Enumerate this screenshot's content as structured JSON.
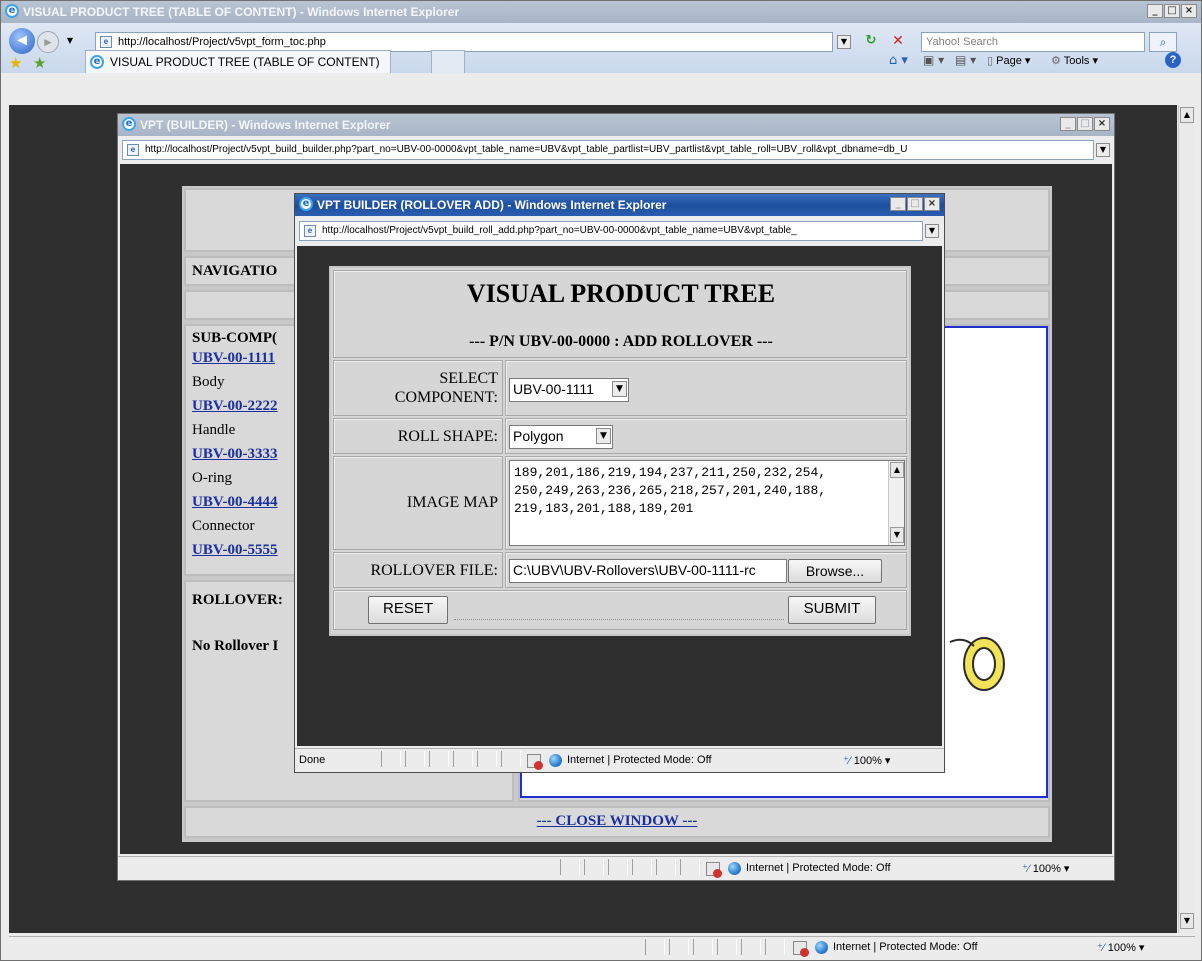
{
  "outer_window": {
    "title": "VISUAL PRODUCT TREE (TABLE OF CONTENT) - Windows Internet Explorer",
    "address": "http://localhost/Project/v5vpt_form_toc.php",
    "search_placeholder": "Yahoo! Search",
    "tab_label": "VISUAL PRODUCT TREE (TABLE OF CONTENT)",
    "toolbar": {
      "page_label": "Page",
      "tools_label": "Tools"
    },
    "status": {
      "zone_text": "Internet | Protected Mode: Off",
      "zoom": "100%"
    }
  },
  "builder_window": {
    "title": "VPT (BUILDER) - Windows Internet Explorer",
    "address": "http://localhost/Project/v5vpt_build_builder.php?part_no=UBV-00-0000&vpt_table_name=UBV&vpt_table_partlist=UBV_partlist&vpt_table_roll=UBV_roll&vpt_dbname=db_U",
    "page": {
      "navigation_heading": "NAVIGATIO",
      "sub_components_heading": "SUB-COMP(",
      "components": [
        {
          "part_no": "UBV-00-1111",
          "name": "Body"
        },
        {
          "part_no": "UBV-00-2222",
          "name": "Handle"
        },
        {
          "part_no": "UBV-00-3333",
          "name": "O-ring"
        },
        {
          "part_no": "UBV-00-4444",
          "name": "Connector"
        },
        {
          "part_no": "UBV-00-5555",
          "name": ""
        }
      ],
      "rollovers_heading": "ROLLOVER:",
      "no_rollover_text": "No Rollover I",
      "close_link": "--- CLOSE WINDOW ---"
    },
    "status": {
      "zone_text": "Internet | Protected Mode: Off",
      "zoom": "100%"
    }
  },
  "popup_window": {
    "title": "VPT BUILDER (ROLLOVER ADD) - Windows Internet Explorer",
    "address": "http://localhost/Project/v5vpt_build_roll_add.php?part_no=UBV-00-0000&vpt_table_name=UBV&vpt_table_",
    "form": {
      "heading": "VISUAL PRODUCT TREE",
      "subheading": "--- P/N UBV-00-0000 : ADD ROLLOVER ---",
      "select_component_label_line1": "SELECT",
      "select_component_label_line2": "COMPONENT:",
      "select_component_value": "UBV-00-1111",
      "roll_shape_label": "ROLL SHAPE:",
      "roll_shape_value": "Polygon",
      "image_map_label": "IMAGE MAP",
      "image_map_value": "189,201,186,219,194,237,211,250,232,254,\n250,249,263,236,265,218,257,201,240,188,\n219,183,201,188,189,201",
      "rollover_file_label": "ROLLOVER FILE:",
      "rollover_file_value": "C:\\UBV\\UBV-Rollovers\\UBV-00-1111-rc",
      "browse_label": "Browse...",
      "reset_label": "RESET",
      "submit_label": "SUBMIT"
    },
    "status": {
      "done_text": "Done",
      "zone_text": "Internet | Protected Mode: Off",
      "zoom": "100%"
    }
  },
  "colors": {
    "active_title": "#1e4f9e",
    "inactive_title": "#b0bccb",
    "page_dark": "#2f2f2f",
    "link": "#1a2f9e",
    "canvas_border": "#1f2fd0"
  },
  "icons": [
    "ie-logo-icon",
    "back-icon",
    "forward-icon",
    "refresh-icon",
    "stop-icon",
    "search-icon",
    "favorites-star-icon",
    "add-favorites-icon",
    "home-icon",
    "feeds-icon",
    "print-icon",
    "page-icon",
    "tools-icon",
    "help-icon",
    "globe-icon",
    "blocked-icon",
    "zoom-icon",
    "page-doc-icon"
  ]
}
